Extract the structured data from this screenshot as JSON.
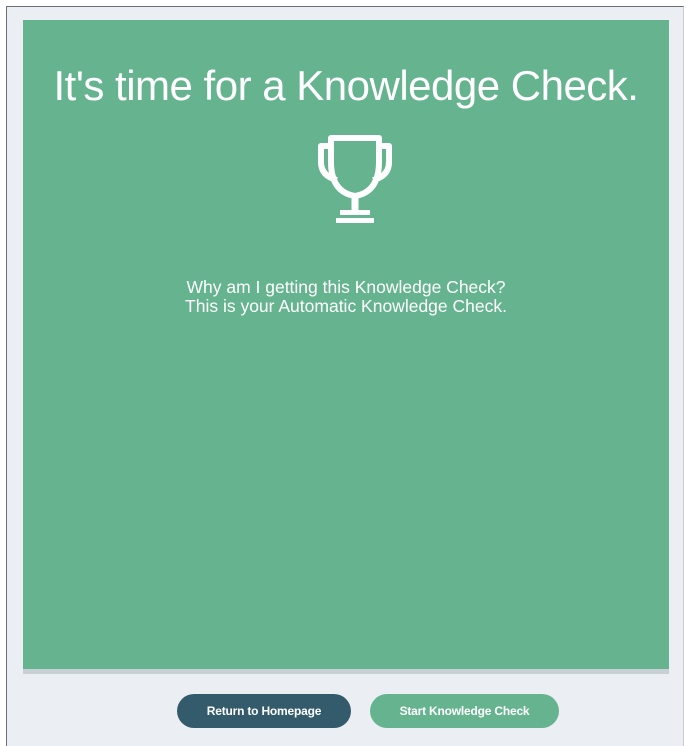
{
  "card": {
    "title": "It's time for a Knowledge Check.",
    "trophy_icon": "trophy-icon",
    "explain_line1": "Why am I getting this Knowledge Check?",
    "explain_line2": "This is your Automatic Knowledge Check.",
    "background_color": "#65b48f"
  },
  "footer": {
    "return_label": "Return to Homepage",
    "start_label": "Start Knowledge Check",
    "return_color": "#335b6b",
    "start_color": "#65b48f"
  }
}
